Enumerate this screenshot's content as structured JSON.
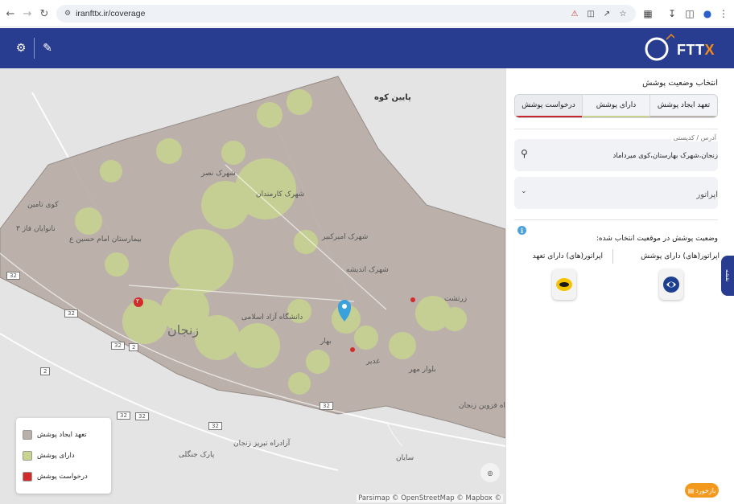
{
  "browser": {
    "url": "iranfttx.ir/coverage",
    "icons": [
      "back-icon",
      "forward-icon",
      "reload-icon",
      "site-info-icon",
      "bookmark-star-icon",
      "extensions-icon",
      "download-icon",
      "sidebar-icon",
      "profile-icon",
      "menu-icon"
    ]
  },
  "header": {
    "logo_text_main": "FTT",
    "logo_text_x": "X",
    "brand_color": "#283d8f",
    "accent_color": "#f28c1a"
  },
  "map": {
    "labels": {
      "city": "زنجان",
      "payin_koh": "پایین کوه",
      "zartosht": "زرتشت",
      "sayan": "سایان",
      "park": "پارک جنگلی",
      "road_tabriz": "آزادراه تبریز زنجان",
      "road_qazvin": "آزادراه قزوین زنجان",
      "kuy_tamin": "کوی تامین",
      "nonvayan": "نانوایان فاز ۳",
      "shahrak_karmandan": "شهرک کارمندان",
      "shahrak_amirkabir": "شهرک امیرکبیر",
      "shahrak_andishe": "شهرک اندیشه",
      "shahrak_nasr": "شهرک نصر",
      "bahar": "بهار",
      "hospital": "بیمارستان امام حسین ع",
      "university": "دانشگاه آزاد اسلامی",
      "ghadir": "غدیر",
      "bolvar_mehr": "بلوار مهر",
      "marker_count": "۲"
    },
    "road_badges": [
      "32",
      "32",
      "32",
      "32",
      "32",
      "2",
      "2",
      "32",
      "32"
    ],
    "attribution": "Parsimap © OpenStreetMap © Mapbox ©",
    "legend": [
      {
        "label": "تعهد ایجاد پوشش",
        "color": "#b8b0a8"
      },
      {
        "label": "دارای پوشش",
        "color": "#c8d58f"
      },
      {
        "label": "درخواست پوشش",
        "color": "#d12b2b"
      }
    ]
  },
  "panel": {
    "title": "انتخاب وضعیت پوشش",
    "tabs": [
      "تعهد ایجاد پوشش",
      "دارای پوشش",
      "درخواست پوشش"
    ],
    "address_label": "آدرس / کدپستی",
    "address_value": "زنجان،شهرک بهارستان،کوی میرداماد",
    "operator_placeholder": "اپراتور",
    "status_title": "وضعیت پوشش در موقعیت انتخاب شده:",
    "col_has": "اپراتور(های) دارای پوشش",
    "col_commit": "اپراتور(های) دارای تعهد",
    "side_tab": "نقشه",
    "feedback": "بازخورد"
  }
}
